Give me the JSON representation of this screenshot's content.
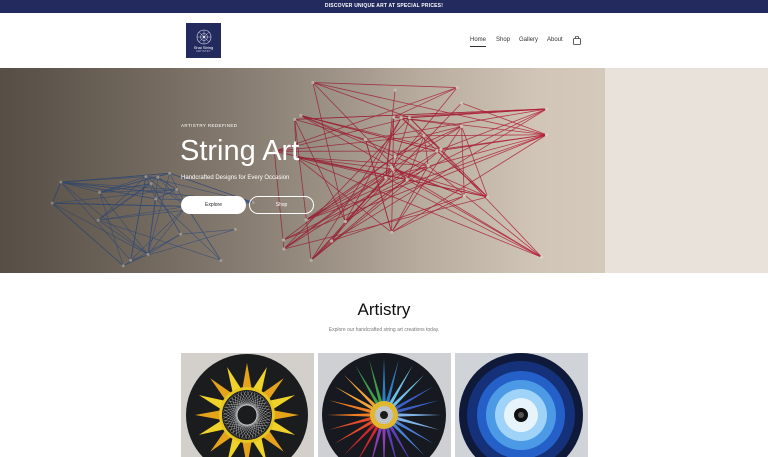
{
  "announcement": "DISCOVER UNIQUE ART AT SPECIAL PRICES!",
  "logo": {
    "name": "Shai String",
    "tagline": "ARTISTRY"
  },
  "nav": {
    "items": [
      "Home",
      "Shop",
      "Gallery",
      "About"
    ],
    "active": "Home",
    "cart_icon": "shopping-bag-icon"
  },
  "hero": {
    "eyebrow": "ARTISTRY REDEFINED",
    "title": "String Art",
    "subtitle": "Handcrafted Designs for Every Occasion",
    "primary_button": "Explore",
    "secondary_button": "Shop"
  },
  "artistry": {
    "title": "Artistry",
    "subtitle": "Explore our handcrafted string art creations today."
  },
  "colors": {
    "announcement_bg": "#232a5e",
    "logo_bg": "#232a5e",
    "hero_red_string": "#b3213a",
    "hero_blue_string": "#3a5f9e"
  }
}
